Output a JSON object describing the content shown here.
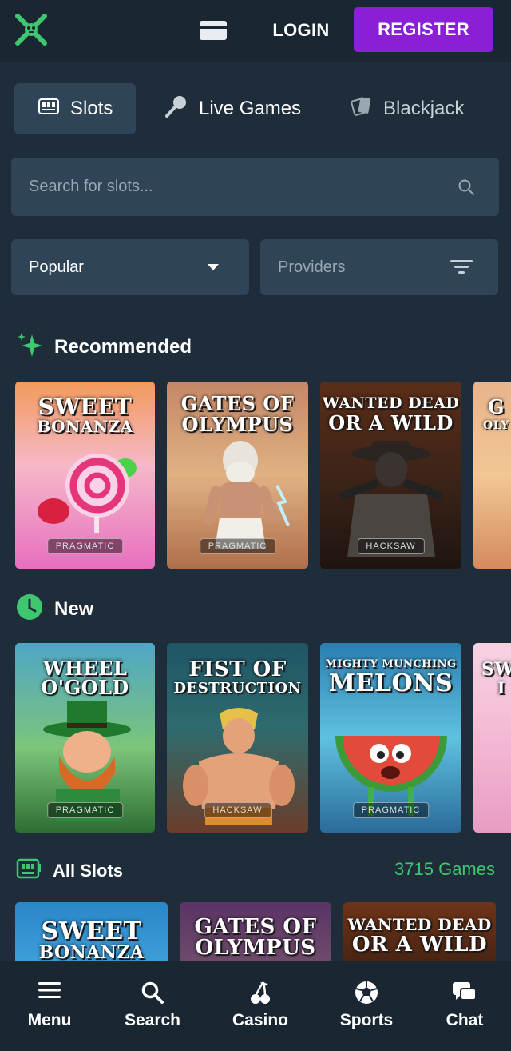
{
  "header": {
    "logo_icon": "crossed-swords-logo",
    "wallet_icon": "credit-card-icon",
    "login_label": "LOGIN",
    "register_label": "REGISTER",
    "register_color": "#8a1fd6"
  },
  "tabs": [
    {
      "label": "Slots",
      "icon": "slot-machine-icon",
      "active": true
    },
    {
      "label": "Live Games",
      "icon": "microphone-icon",
      "active": false
    },
    {
      "label": "Blackjack",
      "icon": "playing-cards-icon",
      "active": false
    }
  ],
  "search": {
    "placeholder": "Search for slots...",
    "value": ""
  },
  "filters": {
    "sort_value": "Popular",
    "providers_label": "Providers"
  },
  "sections": {
    "recommended": {
      "title": "Recommended",
      "icon": "sparkle-icon"
    },
    "new": {
      "title": "New",
      "icon": "clock-icon"
    },
    "all": {
      "title": "All Slots",
      "icon": "slot-machine-icon",
      "count": "3715 Games"
    }
  },
  "recommended_games": [
    {
      "line1": "SWEET",
      "line2": "BONANZA"
    },
    {
      "line1": "GATES OF",
      "line2": "OLYMPUS"
    },
    {
      "line1": "WANTED DEAD",
      "line2": "OR A WILD"
    },
    {
      "line1": "G",
      "line2": "OLY"
    }
  ],
  "new_games": [
    {
      "line1": "WHEEL",
      "line2": "O'GOLD"
    },
    {
      "line1": "FIST OF",
      "line2": "DESTRUCTION"
    },
    {
      "line1": "MIGHTY MUNCHING",
      "line2": "MELONS"
    },
    {
      "line1": "SW",
      "line2": "I"
    }
  ],
  "all_games": [
    {
      "line1": "SWEET",
      "line2": "BONANZA"
    },
    {
      "line1": "GATES OF",
      "line2": "OLYMPUS"
    },
    {
      "line1": "WANTED DEAD",
      "line2": "OR A WILD"
    }
  ],
  "bottom_nav": [
    {
      "label": "Menu",
      "icon": "hamburger-icon"
    },
    {
      "label": "Search",
      "icon": "search-icon"
    },
    {
      "label": "Casino",
      "icon": "cherries-icon"
    },
    {
      "label": "Sports",
      "icon": "soccer-ball-icon"
    },
    {
      "label": "Chat",
      "icon": "chat-bubbles-icon"
    }
  ],
  "colors": {
    "background": "#1f2d3b",
    "panel": "#2f4456",
    "accent_green": "#3fc770"
  }
}
